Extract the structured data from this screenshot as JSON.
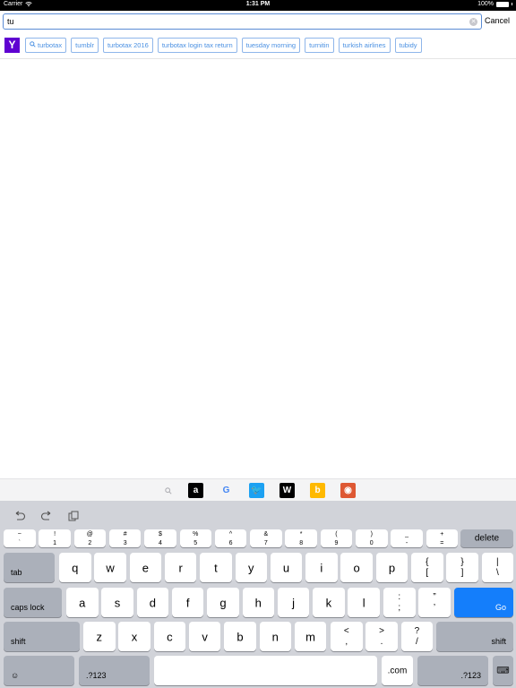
{
  "status_bar": {
    "carrier": "Carrier",
    "time": "1:31 PM",
    "battery": "100%"
  },
  "search": {
    "query": "tu",
    "cancel_label": "Cancel"
  },
  "suggestions": {
    "provider_logo": "Y",
    "items": [
      "turbotax",
      "tumblr",
      "turbotax 2016",
      "turbotax login tax return",
      "tuesday morning",
      "turnitin",
      "turkish airlines",
      "tubidy"
    ]
  },
  "engines": [
    {
      "name": "amazon",
      "glyph": "a",
      "bg": "#000000",
      "fg": "#ffffff"
    },
    {
      "name": "google",
      "glyph": "G",
      "bg": "transparent",
      "fg": "#4285f4"
    },
    {
      "name": "twitter",
      "glyph": "🐦",
      "bg": "#1da1f2",
      "fg": "#ffffff"
    },
    {
      "name": "wikipedia",
      "glyph": "W",
      "bg": "#000000",
      "fg": "#ffffff"
    },
    {
      "name": "bing",
      "glyph": "b",
      "bg": "#ffb900",
      "fg": "#ffffff"
    },
    {
      "name": "duckduckgo",
      "glyph": "◉",
      "bg": "#de5833",
      "fg": "#ffffff"
    }
  ],
  "keyboard": {
    "row0": [
      {
        "top": "~",
        "bot": "`"
      },
      {
        "top": "!",
        "bot": "1"
      },
      {
        "top": "@",
        "bot": "2"
      },
      {
        "top": "#",
        "bot": "3"
      },
      {
        "top": "$",
        "bot": "4"
      },
      {
        "top": "%",
        "bot": "5"
      },
      {
        "top": "^",
        "bot": "6"
      },
      {
        "top": "&",
        "bot": "7"
      },
      {
        "top": "*",
        "bot": "8"
      },
      {
        "top": "(",
        "bot": "9"
      },
      {
        "top": ")",
        "bot": "0"
      },
      {
        "top": "_",
        "bot": "-"
      },
      {
        "top": "+",
        "bot": "="
      }
    ],
    "delete_label": "delete",
    "tab_label": "tab",
    "row1": [
      "q",
      "w",
      "e",
      "r",
      "t",
      "y",
      "u",
      "i",
      "o",
      "p"
    ],
    "row1_punct": [
      {
        "top": "{",
        "bot": "["
      },
      {
        "top": "}",
        "bot": "]"
      },
      {
        "top": "|",
        "bot": "\\"
      }
    ],
    "caps_label": "caps lock",
    "row2": [
      "a",
      "s",
      "d",
      "f",
      "g",
      "h",
      "j",
      "k",
      "l"
    ],
    "row2_punct": [
      {
        "top": ":",
        "bot": ";"
      },
      {
        "top": "”",
        "bot": "’"
      }
    ],
    "go_label": "Go",
    "shift_label": "shift",
    "row3": [
      "z",
      "x",
      "c",
      "v",
      "b",
      "n",
      "m"
    ],
    "row3_punct": [
      {
        "top": "<",
        "bot": ","
      },
      {
        "top": ">",
        "bot": "."
      },
      {
        "top": "?",
        "bot": "/"
      }
    ],
    "emoji_glyph": "☺",
    "num_label": ".?123",
    "dotcom_label": ".com",
    "keyboard_glyph": "⌨"
  }
}
